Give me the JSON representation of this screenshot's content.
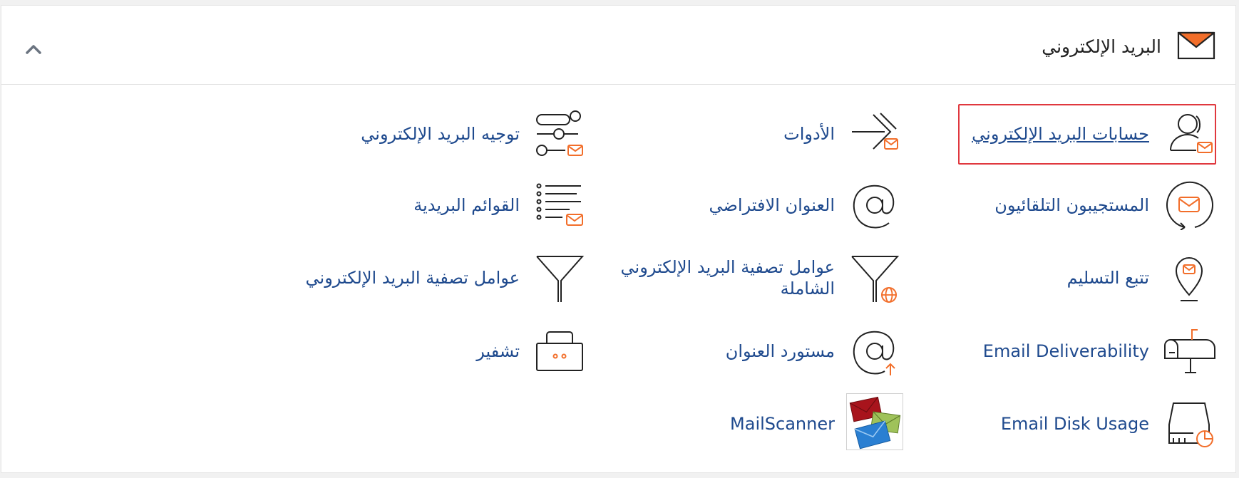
{
  "section": {
    "title": "البريد الإلكتروني",
    "icon": "envelope-icon",
    "collapse_icon": "chevron-up-icon"
  },
  "colors": {
    "accent_orange": "#f26e2a",
    "link_blue": "#1f4a8e",
    "highlight_red": "#e0383e",
    "icon_stroke": "#222222"
  },
  "items": {
    "email_accounts": {
      "label": "حسابات البريد الإلكتروني",
      "icon": "user-mail-icon",
      "highlighted": true
    },
    "forwarders": {
      "label": "الأدوات",
      "icon": "forward-arrow-mail-icon"
    },
    "email_routing": {
      "label": "توجيه البريد الإلكتروني",
      "icon": "routing-mail-icon"
    },
    "autoresponders": {
      "label": "المستجيبون التلقائيون",
      "icon": "autoresponder-icon"
    },
    "default_address": {
      "label": "العنوان الافتراضي",
      "icon": "at-sign-icon"
    },
    "mailing_lists": {
      "label": "القوائم البريدية",
      "icon": "list-mail-icon"
    },
    "track_delivery": {
      "label": "تتبع التسليم",
      "icon": "location-pin-mail-icon"
    },
    "global_filters": {
      "label": "عوامل تصفية البريد الإلكتروني الشاملة",
      "icon": "filter-globe-icon"
    },
    "email_filters": {
      "label": "عوامل تصفية البريد الإلكتروني",
      "icon": "filter-funnel-icon"
    },
    "email_deliverability": {
      "label": "Email Deliverability",
      "icon": "mailbox-icon"
    },
    "address_importer": {
      "label": "مستورد العنوان",
      "icon": "at-upload-icon"
    },
    "encryption": {
      "label": "تشفير",
      "icon": "encryption-key-icon"
    },
    "disk_usage": {
      "label": "Email Disk Usage",
      "icon": "disk-usage-icon"
    },
    "mailscanner": {
      "label": "MailScanner",
      "icon": "mailscanner-envelopes-icon"
    }
  }
}
